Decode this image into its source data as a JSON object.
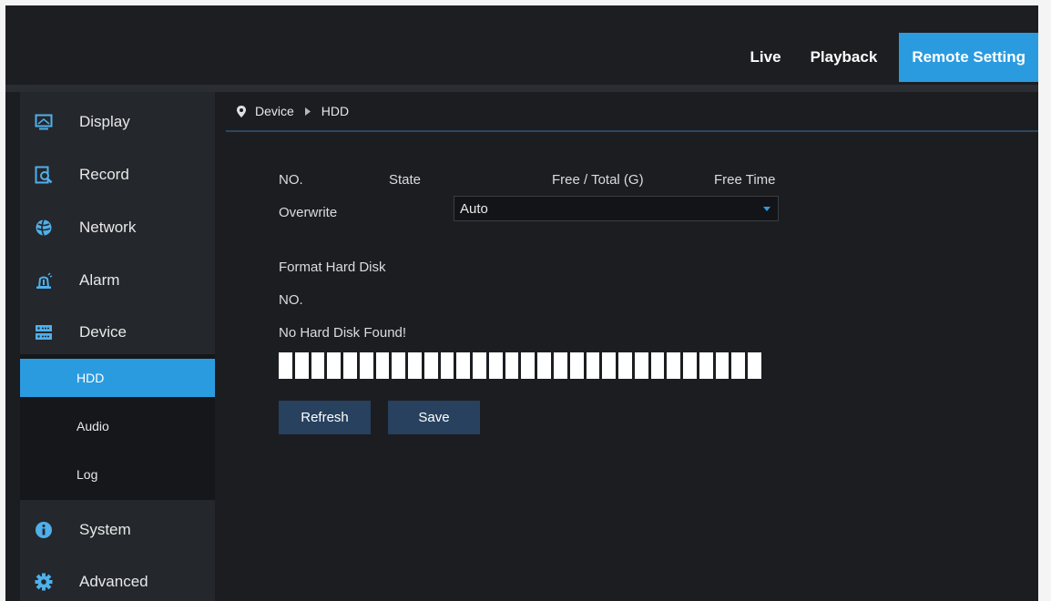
{
  "topnav": {
    "items": [
      {
        "label": "Live",
        "active": false
      },
      {
        "label": "Playback",
        "active": false
      },
      {
        "label": "Remote Setting",
        "active": true
      }
    ]
  },
  "sidebar": {
    "items": [
      {
        "label": "Display",
        "icon": "display-icon"
      },
      {
        "label": "Record",
        "icon": "record-icon"
      },
      {
        "label": "Network",
        "icon": "network-icon"
      },
      {
        "label": "Alarm",
        "icon": "alarm-icon"
      },
      {
        "label": "Device",
        "icon": "device-icon"
      },
      {
        "label": "System",
        "icon": "info-icon"
      },
      {
        "label": "Advanced",
        "icon": "gear-icon"
      }
    ],
    "subitems": [
      {
        "label": "HDD",
        "active": true
      },
      {
        "label": "Audio",
        "active": false
      },
      {
        "label": "Log",
        "active": false
      }
    ]
  },
  "breadcrumb": {
    "parent": "Device",
    "current": "HDD"
  },
  "hdd": {
    "columns": [
      "NO.",
      "State",
      "Free / Total (G)",
      "Free Time"
    ],
    "overwrite_label": "Overwrite",
    "overwrite_value": "Auto",
    "format_title": "Format Hard Disk",
    "format_no_label": "NO.",
    "message": "No Hard Disk Found!",
    "segment_count": 30,
    "refresh_label": "Refresh",
    "save_label": "Save"
  },
  "colors": {
    "accent": "#2b9be0",
    "button": "#27415e",
    "background": "#1b1d21",
    "sidebar": "#24272c"
  }
}
